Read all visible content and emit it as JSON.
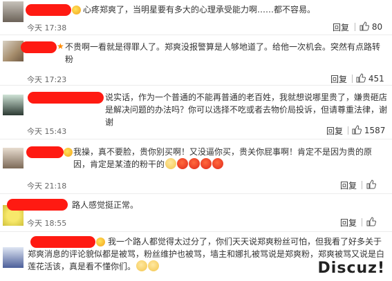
{
  "comments": [
    {
      "text": "心疼郑爽了，当明星要有多大的心理承受能力啊……都不容易。",
      "time": "今天 17:38",
      "reply": "回复",
      "likes": "80",
      "badge": "gold"
    },
    {
      "text": "不贵啊一看就是得罪人了。郑爽没报警算是人够地道了。给他一次机会。突然有点路转粉",
      "time": "今天 17:23",
      "reply": "回复",
      "likes": "451",
      "badge": "star"
    },
    {
      "text": "说实话，作为一个普通的不能再普通的老百姓，我就想说哪里贵了，嫌贵砸店是解决问题的办法吗？你可以选择不吃或者去物价局投诉，但请尊重法律，谢谢",
      "time": "今天 15:43",
      "reply": "回复",
      "likes": "1587",
      "badge": "none"
    },
    {
      "text": "我操，真不要脸，贵你别买啊！又没逼你买，贵关你屁事啊！肯定不是因为贵的原因，肯定是某渣的粉干的",
      "time": "今天 21:18",
      "reply": "回复",
      "likes": "",
      "badge": "gold"
    },
    {
      "text": "路人感觉挺正常。",
      "time": "今天 18:55",
      "reply": "回复",
      "likes": "",
      "badge": "none"
    },
    {
      "text": "我一个路人都觉得太过分了，你们天天说郑爽粉丝可怕，但我看了好多关于郑爽消息的评论貌似都是被骂，粉丝维护也被骂，墙主和娜扎被骂说是郑爽粉，郑爽被骂又说是白莲花活该，真是看不懂你们。",
      "time": "",
      "reply": "",
      "likes": "",
      "badge": "gold"
    }
  ],
  "watermark": "Discuz!",
  "colors": {
    "redaction": "#ff1a12",
    "text": "#333333",
    "meta": "#666666"
  },
  "icons": {
    "like": "thumb-up-icon",
    "badge": "vip-badge-icon",
    "emoji": "angry-face-emoji"
  }
}
